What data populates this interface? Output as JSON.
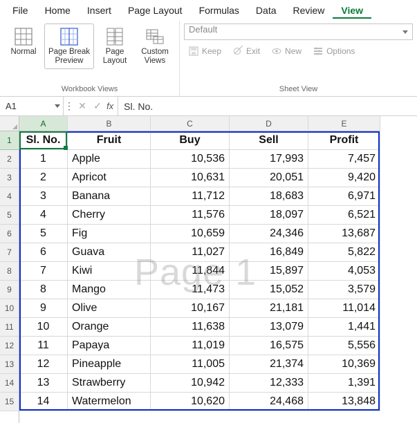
{
  "menu": {
    "items": [
      "File",
      "Home",
      "Insert",
      "Page Layout",
      "Formulas",
      "Data",
      "Review",
      "View"
    ],
    "active": "View"
  },
  "ribbon": {
    "workbook_views": {
      "label": "Workbook Views",
      "normal": "Normal",
      "page_break": "Page Break Preview",
      "page_layout": "Page Layout",
      "custom_views": "Custom Views",
      "selected": "page_break"
    },
    "sheet_view": {
      "label": "Sheet View",
      "dropdown": "Default",
      "keep": "Keep",
      "exit": "Exit",
      "new": "New",
      "options": "Options"
    }
  },
  "formula_bar": {
    "namebox": "A1",
    "fx": "fx",
    "formula": "Sl. No."
  },
  "columns": [
    "A",
    "B",
    "C",
    "D",
    "E"
  ],
  "col_widths": {
    "A": 70,
    "B": 120,
    "C": 114,
    "D": 114,
    "E": 104
  },
  "rows_shown": 15,
  "active_cell": "A1",
  "watermark": "Page 1",
  "chart_data": {
    "type": "table",
    "headers": [
      "Sl. No.",
      "Fruit",
      "Buy",
      "Sell",
      "Profit"
    ],
    "rows": [
      [
        1,
        "Apple",
        10536,
        17993,
        7457
      ],
      [
        2,
        "Apricot",
        10631,
        20051,
        9420
      ],
      [
        3,
        "Banana",
        11712,
        18683,
        6971
      ],
      [
        4,
        "Cherry",
        11576,
        18097,
        6521
      ],
      [
        5,
        "Fig",
        10659,
        24346,
        13687
      ],
      [
        6,
        "Guava",
        11027,
        16849,
        5822
      ],
      [
        7,
        "Kiwi",
        11844,
        15897,
        4053
      ],
      [
        8,
        "Mango",
        11473,
        15052,
        3579
      ],
      [
        9,
        "Olive",
        10167,
        21181,
        11014
      ],
      [
        10,
        "Orange",
        11638,
        13079,
        1441
      ],
      [
        11,
        "Papaya",
        11019,
        16575,
        5556
      ],
      [
        12,
        "Pineapple",
        11005,
        21374,
        10369
      ],
      [
        13,
        "Strawberry",
        10942,
        12333,
        1391
      ],
      [
        14,
        "Watermelon",
        10620,
        24468,
        13848
      ]
    ]
  }
}
